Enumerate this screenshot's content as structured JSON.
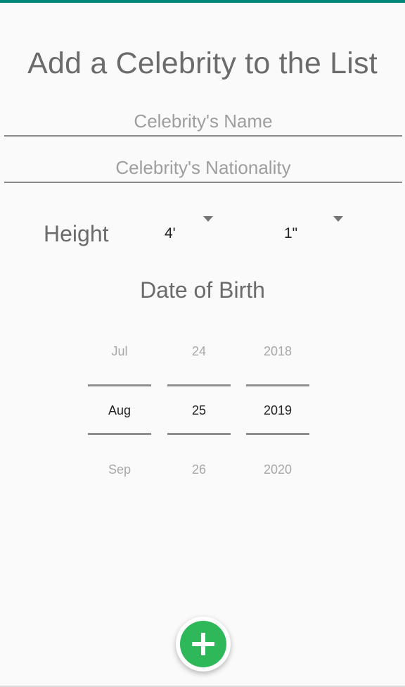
{
  "form": {
    "title": "Add a Celebrity to the List",
    "name_field": {
      "value": "",
      "placeholder": "Celebrity's Name"
    },
    "nationality_field": {
      "value": "",
      "placeholder": "Celebrity's Nationality"
    },
    "height": {
      "label": "Height",
      "feet": "4'",
      "inches": "1\""
    },
    "date_of_birth": {
      "label": "Date of Birth",
      "month": {
        "prev": "Jul",
        "selected": "Aug",
        "next": "Sep"
      },
      "day": {
        "prev": "24",
        "selected": "25",
        "next": "26"
      },
      "year": {
        "prev": "2018",
        "selected": "2019",
        "next": "2020"
      }
    }
  },
  "fab": {
    "icon": "plus-icon"
  },
  "colors": {
    "status_bar": "#00897b",
    "fab_green": "#2fb85a",
    "text_gray": "#6b6b6b",
    "background": "#fafafa"
  }
}
